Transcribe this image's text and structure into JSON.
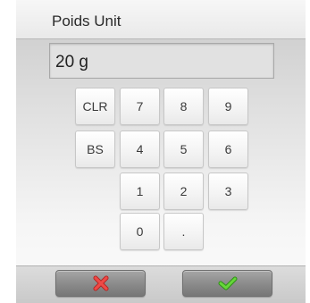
{
  "dialog": {
    "title": "Poids Unit",
    "display_value": "20 g"
  },
  "keypad": {
    "clear": "CLR",
    "backspace": "BS",
    "k7": "7",
    "k8": "8",
    "k9": "9",
    "k4": "4",
    "k5": "5",
    "k6": "6",
    "k1": "1",
    "k2": "2",
    "k3": "3",
    "k0": "0",
    "decimal": "."
  },
  "footer": {
    "cancel_icon": "red-x-icon",
    "confirm_icon": "green-check-icon",
    "colors": {
      "cancel": "#e8403d",
      "confirm": "#5cc82f"
    }
  }
}
